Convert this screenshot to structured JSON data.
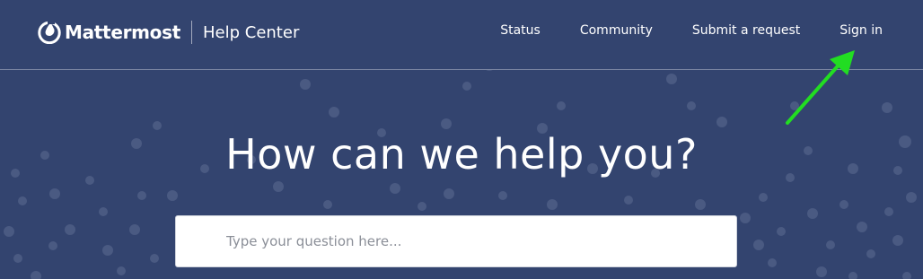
{
  "brand": {
    "logo_icon": "mattermost-logo-icon",
    "name": "Mattermost",
    "section": "Help Center"
  },
  "nav": {
    "status": "Status",
    "community": "Community",
    "submit": "Submit a request",
    "signin": "Sign in"
  },
  "hero": {
    "title": "How can we help you?"
  },
  "search": {
    "placeholder": "Type your question here..."
  },
  "annotation": {
    "arrow_icon": "arrow-pointer-icon",
    "arrow_color": "#22dd22"
  },
  "colors": {
    "background": "#33446f",
    "dots": "#4a5a82"
  }
}
